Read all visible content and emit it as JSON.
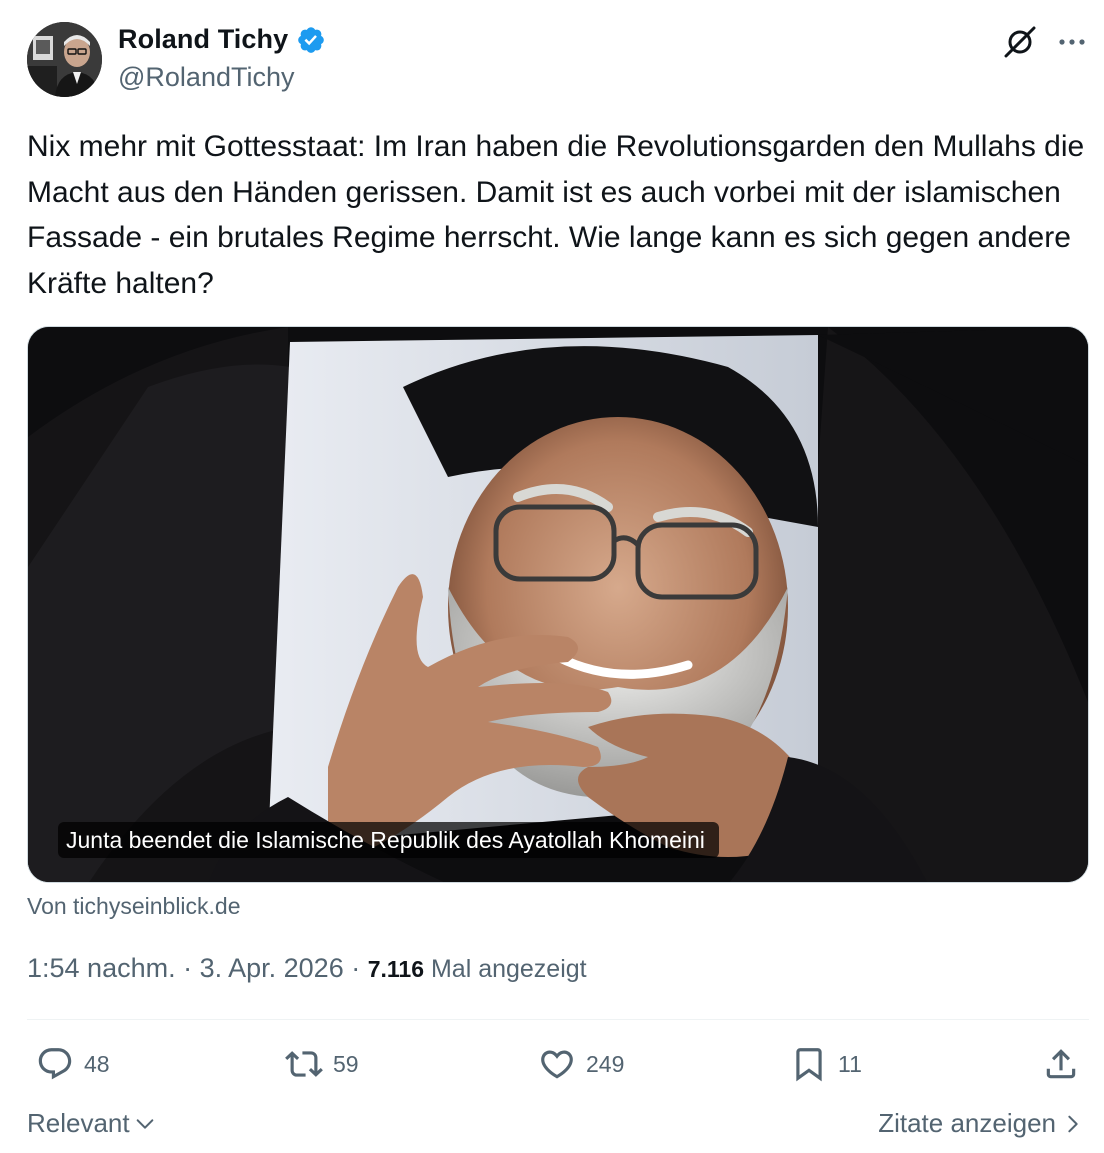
{
  "author": {
    "display_name": "Roland Tichy",
    "handle": "@RolandTichy",
    "verified": true,
    "verified_color": "#1d9bf0"
  },
  "tweet": {
    "text": "Nix mehr mit Gottesstaat: Im Iran haben die Revolutionsgarden den Mullahs die Macht aus den Händen gerissen. Damit ist es auch vorbei mit der islamischen Fassade - ein brutales Regime herrscht. Wie lange kann es sich gegen andere Kräfte halten?"
  },
  "card": {
    "title": "Junta beendet die Islamische Republik des Ayatollah Khomeini",
    "source": "Von tichyseinblick.de"
  },
  "meta": {
    "time": "1:54 nachm.",
    "separator": " · ",
    "date": "3. Apr. 2026",
    "separator2": " · ",
    "views_count": "7.116",
    "views_label": " Mal angezeigt"
  },
  "actions": {
    "replies": "48",
    "reposts": "59",
    "likes": "249",
    "bookmarks": "11"
  },
  "footer": {
    "sort_label": "Relevant",
    "quotes_label": "Zitate anzeigen"
  },
  "icons": {
    "avatar": "avatar-photo",
    "verified": "verified-badge-icon",
    "grok": "grok-icon",
    "more": "more-icon",
    "reply": "reply-icon",
    "repost": "repost-icon",
    "like": "heart-icon",
    "bookmark": "bookmark-icon",
    "share": "share-icon"
  }
}
